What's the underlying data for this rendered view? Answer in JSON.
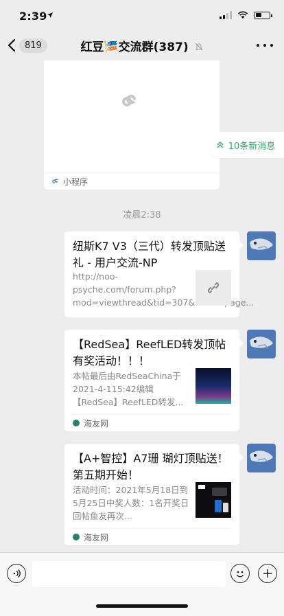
{
  "status": {
    "time": "2:39"
  },
  "nav": {
    "back_count": "819",
    "title": "红豆🎏交流群(387)"
  },
  "mini_program": {
    "label": "小程序"
  },
  "new_messages": {
    "label": "10条新消息"
  },
  "timestamp": "凌晨2:38",
  "messages": [
    {
      "title": "纽斯K7 V3（三代）转发顶贴送礼 - 用户交流-NP",
      "desc": "http://noo-psyche.com/forum.php?mod=viewthread&tid=307&extra=page...",
      "source": ""
    },
    {
      "title": "【RedSea】ReefLED转发顶帖有奖活动！！！",
      "desc": "本帖最后由RedSeaChina于2021-4-115:42编辑【RedSea】ReefLED转发...",
      "source": "海友网"
    },
    {
      "title": "【A+智控】A7珊 瑚灯顶贴送！第五期开始！",
      "desc": "活动时间：2021年5月18日到5月25日中奖人数：1名开奖日回帖鱼友再次...",
      "source": "海友网"
    }
  ],
  "colors": {
    "accent_green": "#2aae67",
    "background": "#ededed",
    "avatar_blue": "#4f79b6"
  },
  "icons": [
    "back-chevron-icon",
    "mute-icon",
    "more-icon",
    "chevron-up-icon",
    "link-icon",
    "voice-icon",
    "emoji-icon",
    "plus-icon"
  ]
}
